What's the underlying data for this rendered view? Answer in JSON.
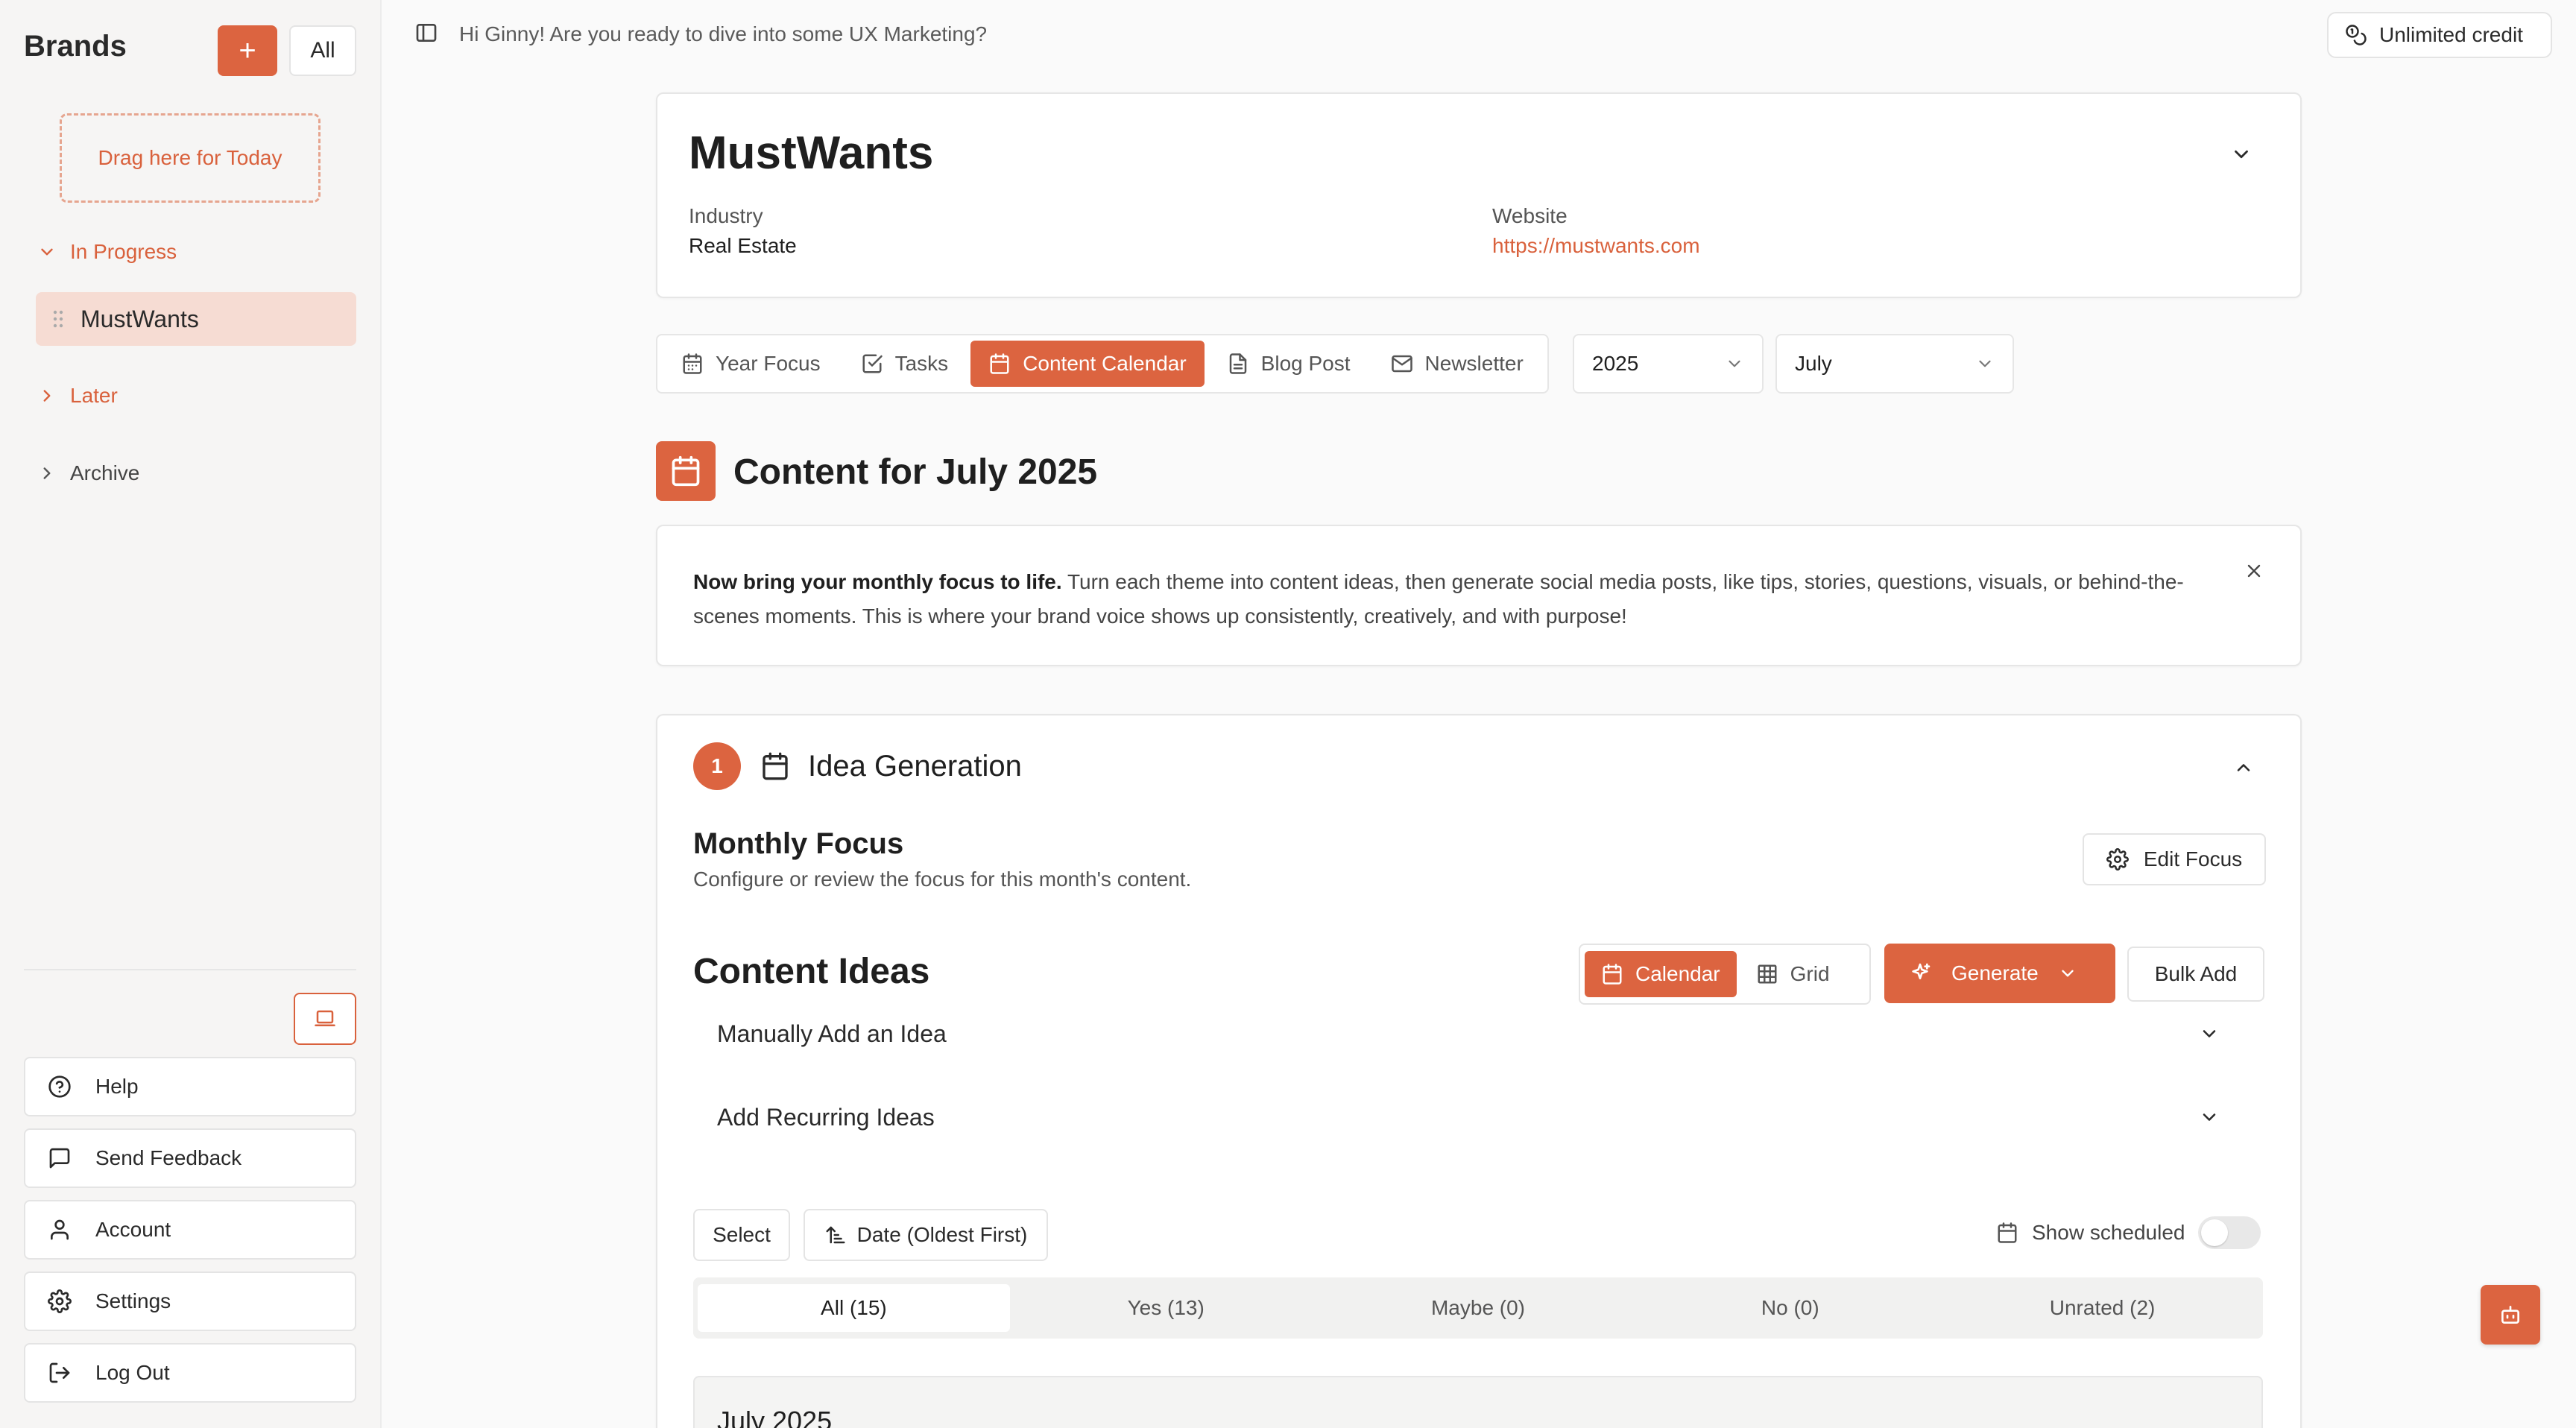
{
  "sidebar": {
    "title": "Brands",
    "add_label": "+",
    "all_label": "All",
    "dropzone_label": "Drag here for Today",
    "groups": {
      "in_progress": "In Progress",
      "later": "Later",
      "archive": "Archive"
    },
    "brand_item": "MustWants",
    "bottom": {
      "help": "Help",
      "feedback": "Send Feedback",
      "account": "Account",
      "settings": "Settings",
      "logout": "Log Out"
    }
  },
  "topbar": {
    "greeting": "Hi Ginny! Are you ready to dive into some UX Marketing?",
    "credit": "Unlimited credit"
  },
  "brand": {
    "name": "MustWants",
    "industry_label": "Industry",
    "industry": "Real Estate",
    "website_label": "Website",
    "website": "https://mustwants.com"
  },
  "tabs": {
    "year_focus": "Year Focus",
    "tasks": "Tasks",
    "content_calendar": "Content Calendar",
    "blog_post": "Blog Post",
    "newsletter": "Newsletter"
  },
  "selects": {
    "year": "2025",
    "month": "July"
  },
  "section": {
    "title": "Content for July 2025"
  },
  "info": {
    "bold": "Now bring your monthly focus to life.",
    "text": " Turn each theme into content ideas, then generate social media posts, like tips, stories, questions, visuals, or behind-the-scenes moments. This is where your brand voice shows up consistently, creatively, and with purpose!"
  },
  "idea": {
    "step": "1",
    "title": "Idea Generation",
    "monthly_focus_title": "Monthly Focus",
    "monthly_focus_sub": "Configure or review the focus for this month's content.",
    "edit_focus": "Edit Focus",
    "content_ideas_title": "Content Ideas",
    "calendar_label": "Calendar",
    "grid_label": "Grid",
    "generate_label": "Generate",
    "bulk_add_label": "Bulk Add",
    "manual_add": "Manually Add an Idea",
    "recurring": "Add Recurring Ideas",
    "select_label": "Select",
    "sort_label": "Date (Oldest First)",
    "show_scheduled": "Show scheduled",
    "filters": [
      "All (15)",
      "Yes (13)",
      "Maybe (0)",
      "No (0)",
      "Unrated (2)"
    ],
    "month_heading": "July 2025"
  },
  "colors": {
    "accent": "#dc6440",
    "accent_light": "#f6dcd3"
  }
}
